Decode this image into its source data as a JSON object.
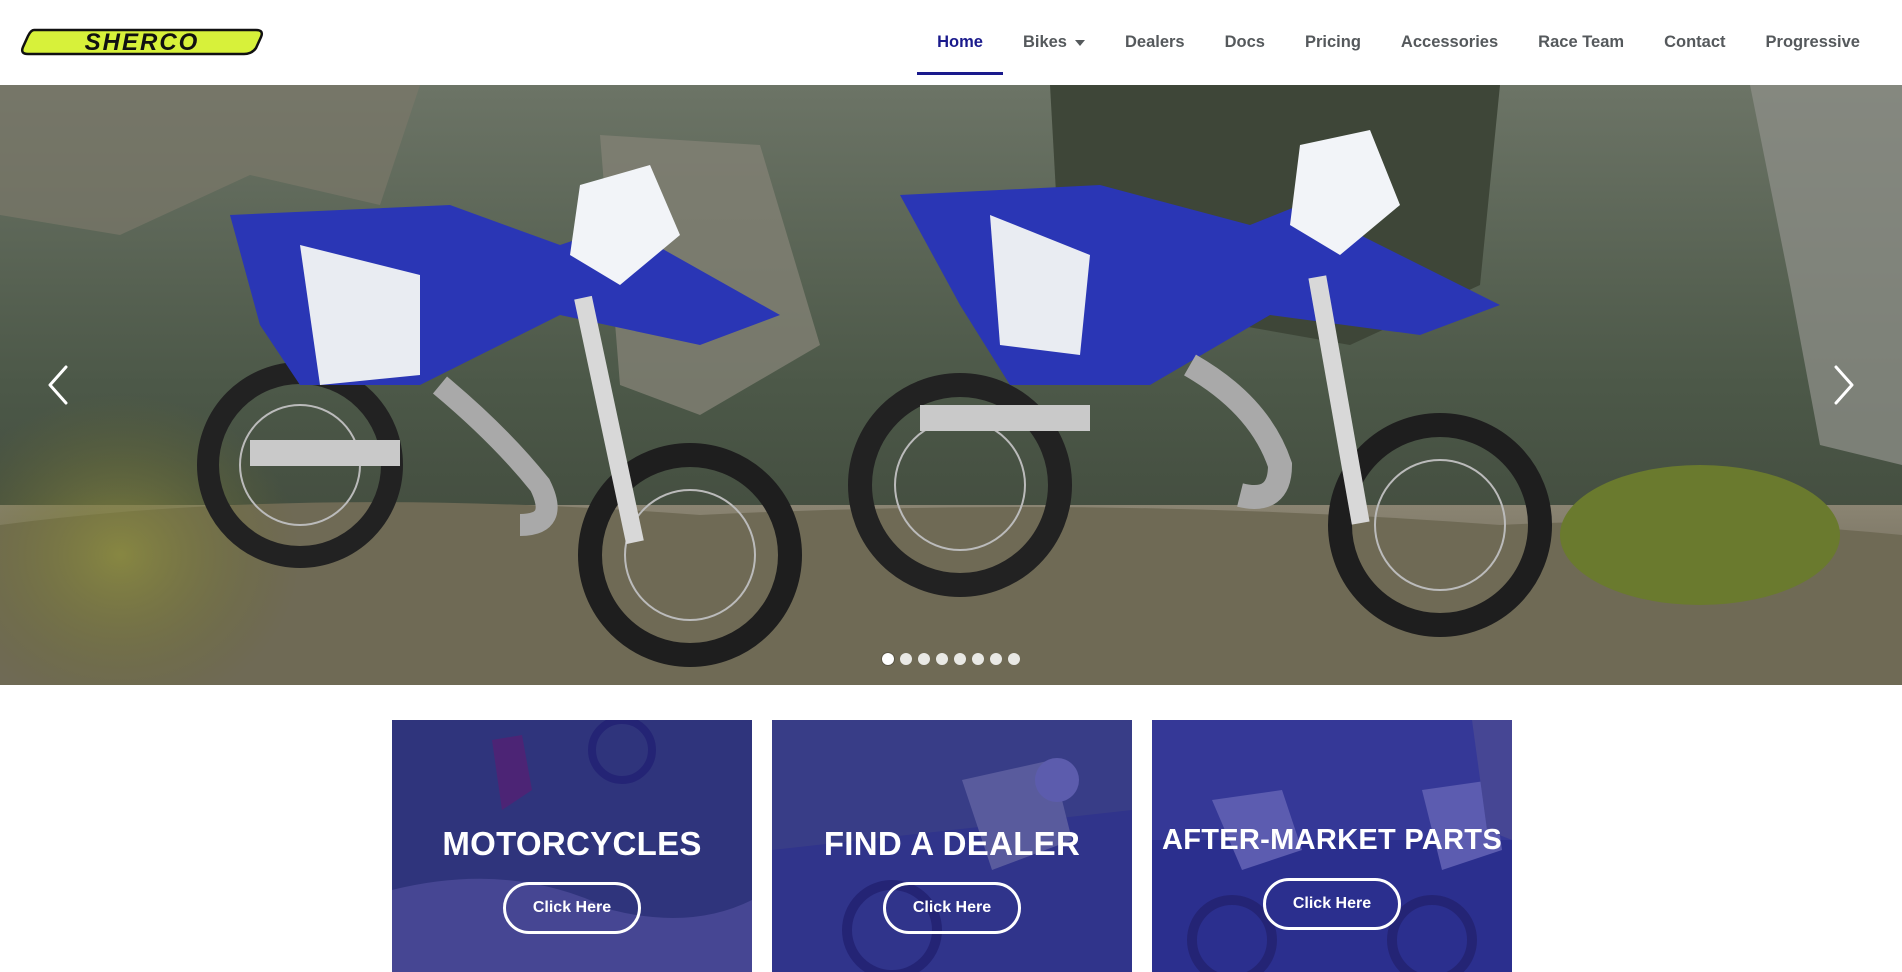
{
  "brand": {
    "logo_text": "SHERCO",
    "logo_color": "#d7f13a"
  },
  "nav": {
    "items": [
      {
        "label": "Home",
        "active": true
      },
      {
        "label": "Bikes",
        "dropdown": true
      },
      {
        "label": "Dealers"
      },
      {
        "label": "Docs"
      },
      {
        "label": "Pricing"
      },
      {
        "label": "Accessories"
      },
      {
        "label": "Race Team"
      },
      {
        "label": "Contact"
      },
      {
        "label": "Progressive"
      }
    ],
    "active_color": "#1a1a8c"
  },
  "hero": {
    "icons": {
      "prev": "chevron-left-icon",
      "next": "chevron-right-icon"
    },
    "slide_count": 8,
    "active_slide": 1
  },
  "cards": [
    {
      "title": "MOTORCYCLES",
      "button": "Click Here"
    },
    {
      "title": "FIND A DEALER",
      "button": "Click Here"
    },
    {
      "title": "AFTER-MARKET PARTS",
      "button": "Click Here"
    }
  ],
  "colors": {
    "card_overlay": "#262696",
    "text_nav": "#55595c"
  }
}
